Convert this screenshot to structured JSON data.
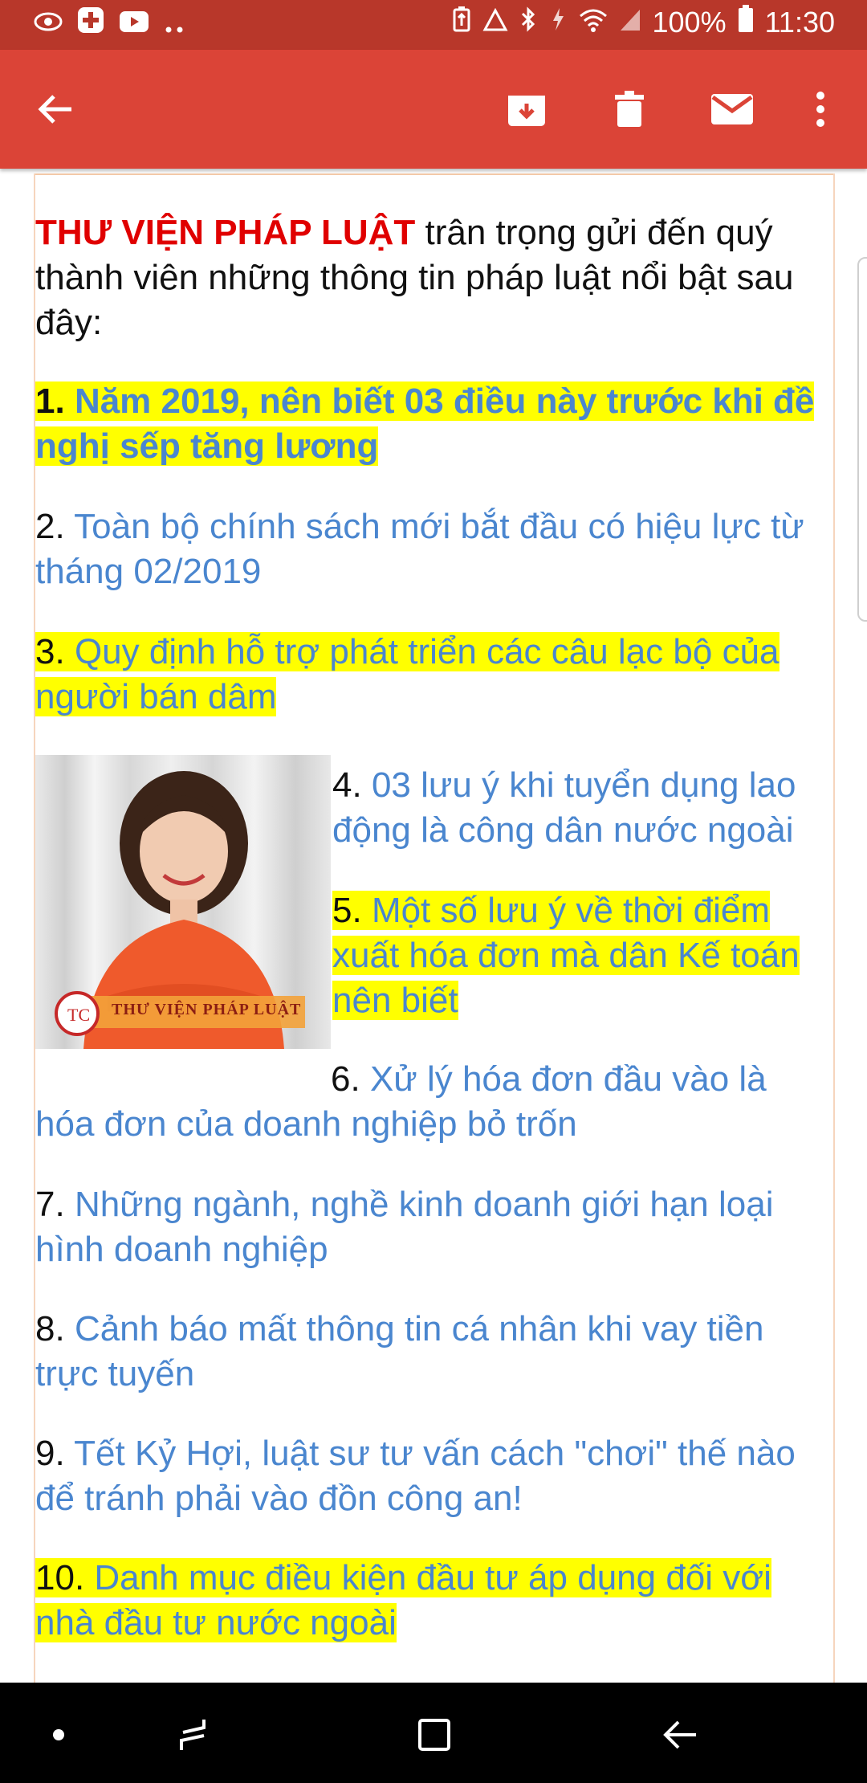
{
  "status_bar": {
    "battery": "100%",
    "time": "11:30",
    "icons": [
      "eye-icon",
      "plus-icon",
      "youtube-icon",
      "more-dots-icon",
      "battery-saver-icon",
      "recycle-icon",
      "bluetooth-icon",
      "data-icon",
      "wifi-icon",
      "signal-icon",
      "battery-icon"
    ]
  },
  "app_bar": {
    "color": "#db4437",
    "actions": [
      "back-arrow-icon",
      "archive-icon",
      "delete-icon",
      "mark-unread-icon",
      "overflow-menu-icon"
    ]
  },
  "email": {
    "intro": {
      "brand": "THƯ VIỆN PHÁP LUẬT",
      "text": " trân trọng gửi đến quý thành viên những thông tin pháp luật nổi bật sau đây:"
    },
    "photo_caption": "THƯ VIỆN PHÁP LUẬT",
    "items": [
      {
        "num": "1.",
        "title": "Năm 2019, nên biết 03 điều này trước khi đề nghị sếp tăng lương"
      },
      {
        "num": "2.",
        "title": "Toàn bộ chính sách mới bắt đầu có hiệu lực từ tháng 02/2019"
      },
      {
        "num": "3.",
        "title": "Quy định hỗ trợ phát triển các câu lạc bộ của người bán dâm"
      },
      {
        "num": "4.",
        "title": "03 lưu ý khi tuyển dụng lao động là công dân nước ngoài"
      },
      {
        "num": "5.",
        "title": "Một số lưu ý về thời điểm xuất hóa đơn mà dân Kế toán nên biết"
      },
      {
        "num": "6.",
        "title": "Xử lý hóa đơn đầu vào là hóa đơn của doanh nghiệp bỏ trốn"
      },
      {
        "num": "7.",
        "title": "Những ngành, nghề kinh doanh giới hạn loại hình doanh nghiệp"
      },
      {
        "num": "8.",
        "title": "Cảnh báo mất thông tin cá nhân khi vay tiền trực tuyến"
      },
      {
        "num": "9.",
        "title": "Tết Kỷ Hợi, luật sư tư vấn cách \"chơi\" thế nào để tránh phải vào đồn công an!"
      },
      {
        "num": "10.",
        "title": "Danh mục điều kiện đầu tư áp dụng đối với nhà đầu tư nước ngoài"
      }
    ]
  },
  "nav_bar": {
    "buttons": [
      "dot-icon",
      "recents-icon",
      "home-icon",
      "back-icon"
    ]
  }
}
